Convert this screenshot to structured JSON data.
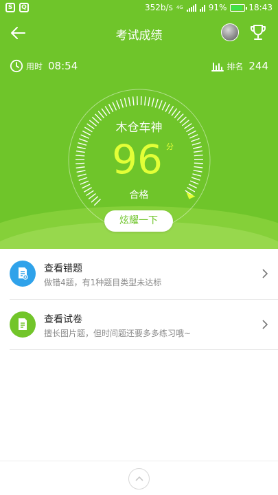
{
  "status_bar": {
    "left_icons": [
      "s-box-icon",
      "q-box-icon"
    ],
    "network_speed": "352b/s",
    "network_type": "4G",
    "battery_percent": "91%",
    "time": "18:43"
  },
  "nav": {
    "title": "考试成绩",
    "back_icon": "arrow-left-icon",
    "avatar_icon": "user-avatar",
    "trophy_icon": "trophy-icon"
  },
  "stats": {
    "time_label": "用时",
    "time_value": "08:54",
    "rank_label": "排名",
    "rank_value": "244"
  },
  "result": {
    "title": "木仓车神",
    "score": "96",
    "score_unit": "分",
    "level": "合格",
    "gauge_fraction": 0.96
  },
  "share_button": "炫耀一下",
  "actions": [
    {
      "title": "查看错题",
      "subtitle": "做错4题，有1种题目类型未达标",
      "icon": "document-error-icon",
      "color": "#2fa2ea"
    },
    {
      "title": "查看试卷",
      "subtitle": "擅长图片题，但时间题还要多多练习哦~",
      "icon": "document-icon",
      "color": "#72c52a"
    }
  ],
  "colors": {
    "primary_green": "#6fc52a",
    "score_yellow": "#e2ff37",
    "blue_icon": "#2fa2ea"
  }
}
